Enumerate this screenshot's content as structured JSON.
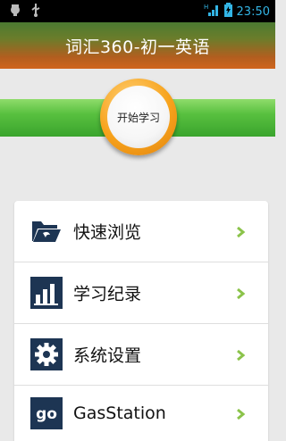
{
  "status_bar": {
    "time": "23:50"
  },
  "app": {
    "title": "词汇360-初一英语"
  },
  "start": {
    "label": "开始学习"
  },
  "menu": {
    "items": [
      {
        "label": "快速浏览",
        "icon": "folder-icon"
      },
      {
        "label": "学习纪录",
        "icon": "bar-chart-icon"
      },
      {
        "label": "系统设置",
        "icon": "gear-icon"
      },
      {
        "label": "GasStation",
        "icon": "go-icon",
        "icon_text": "go"
      }
    ]
  },
  "colors": {
    "accent_blue": "#33b5e5",
    "green": "#4fb73a",
    "orange": "#f7a21b",
    "icon_dark": "#1d3553",
    "chevron": "#8bc34a"
  }
}
